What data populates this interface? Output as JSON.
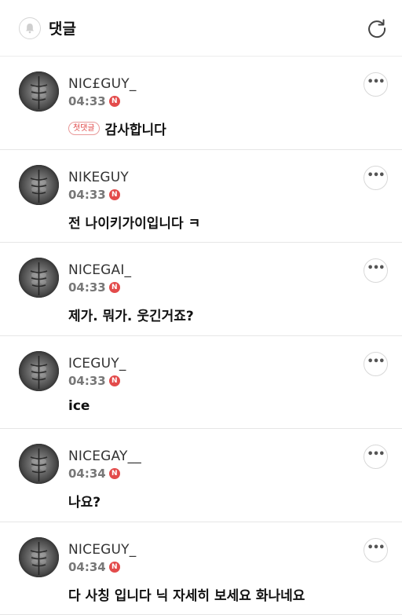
{
  "header": {
    "title": "댓글",
    "bell_icon": "bell-icon",
    "refresh_icon": "refresh-icon"
  },
  "colors": {
    "badge": "#e34b4b",
    "divider": "#e6e6e6"
  },
  "comments": [
    {
      "nickname": "NIC£GUY_",
      "time": "04:33",
      "badge": "N",
      "tag": "첫댓글",
      "text": "감사합니다"
    },
    {
      "nickname": "NIKEGUY",
      "time": "04:33",
      "badge": "N",
      "text": "전 나이키가이입니다 ㅋ"
    },
    {
      "nickname": "NICEGAI_",
      "time": "04:33",
      "badge": "N",
      "text": "제가. 뭐가. 웃긴거죠?"
    },
    {
      "nickname": "ICEGUY_",
      "time": "04:33",
      "badge": "N",
      "text": "ice"
    },
    {
      "nickname": "NICEGAY__",
      "time": "04:34",
      "badge": "N",
      "text": "나요?"
    },
    {
      "nickname": "NICEGUY_",
      "time": "04:34",
      "badge": "N",
      "text": "다 사칭 입니다 닉 자세히 보세요 화나네요"
    }
  ]
}
